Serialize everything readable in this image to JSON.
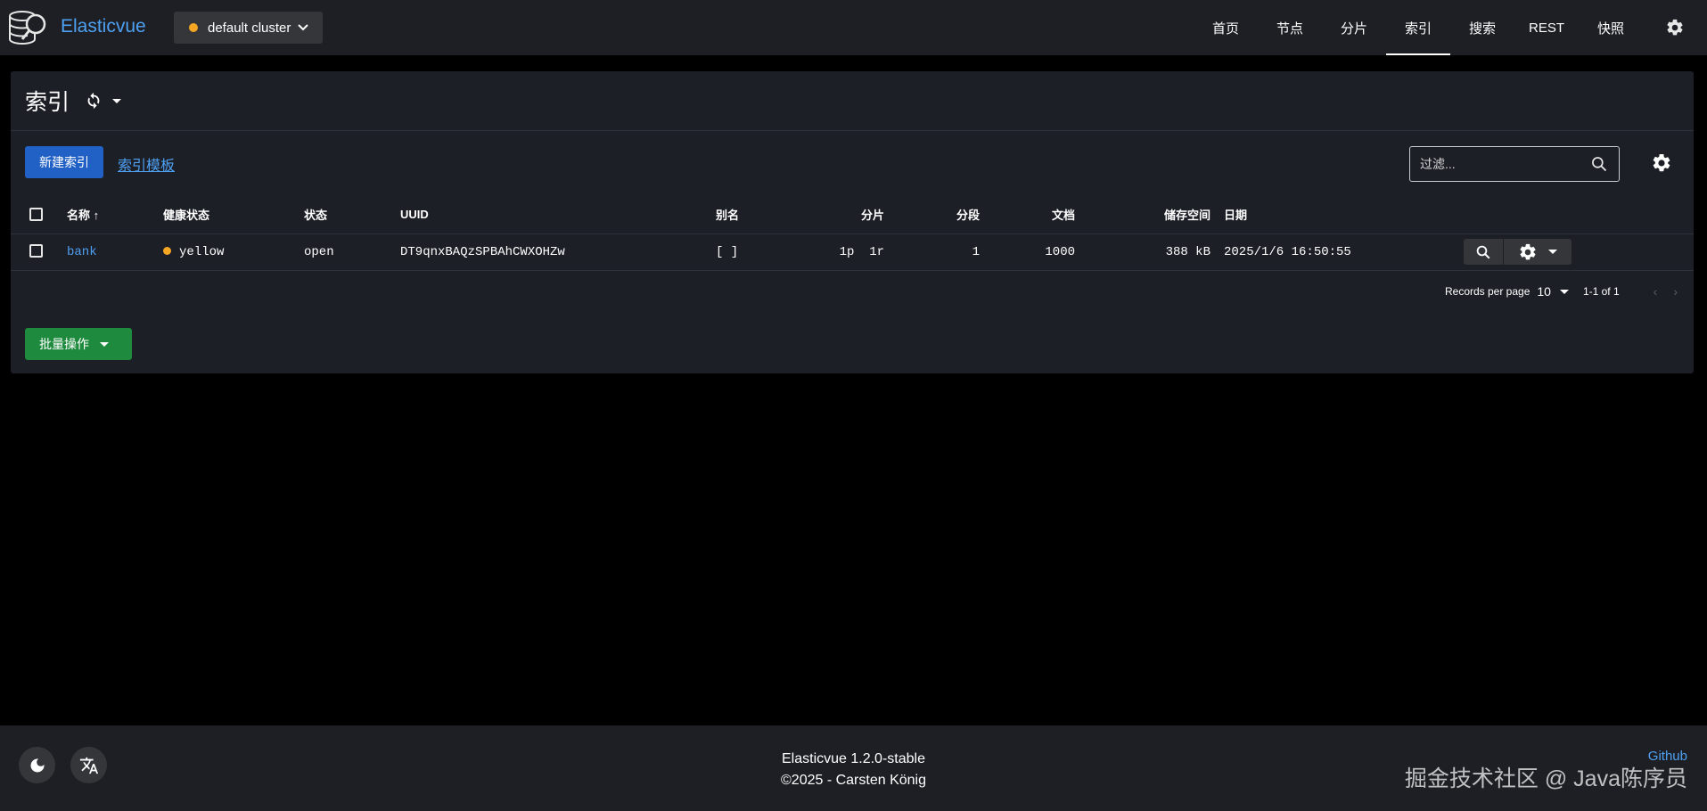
{
  "app": {
    "brand": "Elasticvue"
  },
  "cluster": {
    "name": "default cluster",
    "status_color": "#f5a623"
  },
  "nav": {
    "items": [
      {
        "label": "首页"
      },
      {
        "label": "节点"
      },
      {
        "label": "分片"
      },
      {
        "label": "索引",
        "active": true
      },
      {
        "label": "搜索"
      },
      {
        "label": "REST"
      },
      {
        "label": "快照"
      }
    ]
  },
  "page": {
    "title": "索引",
    "new_index_label": "新建索引",
    "templates_link": "索引模板",
    "filter_placeholder": "过滤..."
  },
  "table": {
    "columns": [
      "名称",
      "健康状态",
      "状态",
      "UUID",
      "别名",
      "分片",
      "分段",
      "文档",
      "储存空间",
      "日期"
    ],
    "sort_indicator": "↑",
    "rows": [
      {
        "name": "bank",
        "health": "yellow",
        "health_color": "#f5a623",
        "status": "open",
        "uuid": "DT9qnxBAQzSPBAhCWXOHZw",
        "aliases": "[ ]",
        "primaries": "1p",
        "replicas": "1r",
        "segments": "1",
        "docs": "1000",
        "storage": "388 kB",
        "date": "2025/1/6 16:50:55"
      }
    ]
  },
  "pager": {
    "records_per_page_label": "Records per page",
    "per_page": "10",
    "range": "1-1 of 1"
  },
  "bulk": {
    "label": "批量操作"
  },
  "footer": {
    "version": "Elasticvue 1.2.0-stable",
    "copyright": "©2025 - Carsten König",
    "github": "Github",
    "watermark": "掘金技术社区 @ Java陈序员"
  },
  "colors": {
    "accent": "#4ea0f2",
    "primary_button": "#2160c4",
    "success_button": "#1e8a3e",
    "warning": "#f5a623"
  }
}
